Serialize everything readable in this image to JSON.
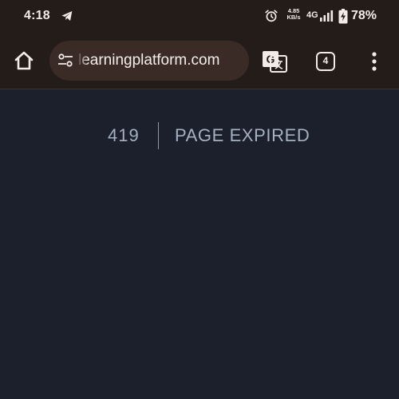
{
  "status_bar": {
    "time": "4:18",
    "net_speed_value": "4.85",
    "net_speed_unit": "KB/s",
    "network_type": "4G",
    "battery": "78%",
    "icons": [
      "telegram-icon",
      "alarm-icon",
      "signal-icon",
      "battery-charging-icon"
    ]
  },
  "toolbar": {
    "url": "learningplatform.com",
    "tab_count": "4",
    "icons": [
      "home-icon",
      "tune-icon",
      "translate-icon",
      "tab-switcher-icon",
      "more-vert-icon"
    ]
  },
  "page": {
    "error_code": "419",
    "error_message": "PAGE EXPIRED"
  },
  "colors": {
    "browser_chrome": "#231c19",
    "omnibox": "#3a2b27",
    "page_background": "#1b202c",
    "error_text": "#a5b0c0"
  }
}
